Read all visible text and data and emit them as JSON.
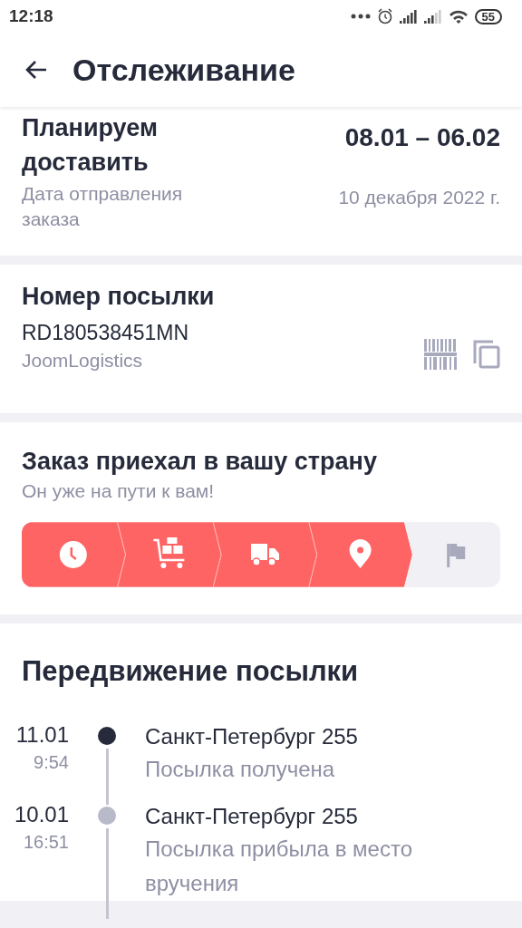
{
  "status_bar": {
    "time": "12:18",
    "battery": "55"
  },
  "header": {
    "title": "Отслеживание"
  },
  "delivery": {
    "title": "Планируем доставить",
    "range": "08.01 – 06.02",
    "sent_label": "Дата отправления заказа",
    "sent_date": "10 декабря 2022 г."
  },
  "parcel": {
    "title": "Номер посылки",
    "number": "RD180538451MN",
    "carrier": "JoomLogistics"
  },
  "status": {
    "title": "Заказ приехал в вашу страну",
    "subtitle": "Он уже на пути к вам!",
    "steps": [
      {
        "kind": "clock",
        "done": true
      },
      {
        "kind": "cart",
        "done": true
      },
      {
        "kind": "truck",
        "done": true
      },
      {
        "kind": "pin",
        "done": true
      },
      {
        "kind": "flag",
        "done": false
      }
    ]
  },
  "movement": {
    "title": "Передвижение посылки",
    "events": [
      {
        "date": "11.01",
        "time": "9:54",
        "place": "Санкт-Петербург 255",
        "text": "Посылка получена",
        "current": true
      },
      {
        "date": "10.01",
        "time": "16:51",
        "place": "Санкт-Петербург 255",
        "text": "Посылка прибыла в место вручения",
        "current": false
      }
    ]
  }
}
